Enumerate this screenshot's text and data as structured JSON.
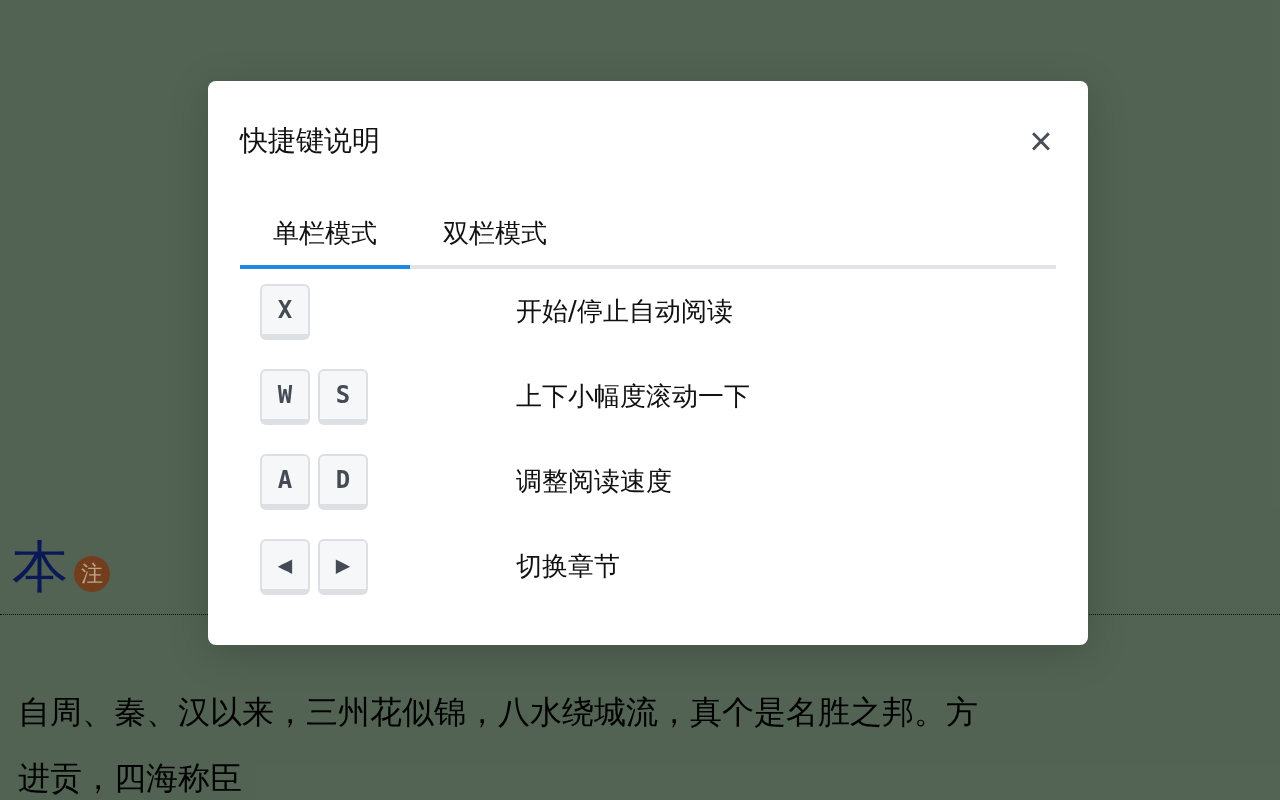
{
  "page": {
    "heading": "本",
    "note_badge": "注",
    "paragraphs": [
      "自周、秦、汉以来，三州花似锦，八水绕城流，真个是名胜之邦。方",
      "进贡，四海称臣"
    ]
  },
  "dialog": {
    "title": "快捷键说明",
    "close": "×",
    "tabs": [
      {
        "label": "单栏模式",
        "selected": true
      },
      {
        "label": "双栏模式",
        "selected": false
      }
    ],
    "shortcuts": [
      {
        "keys": [
          "X"
        ],
        "description": "开始/停止自动阅读"
      },
      {
        "keys": [
          "W",
          "S"
        ],
        "description": "上下小幅度滚动一下"
      },
      {
        "keys": [
          "A",
          "D"
        ],
        "description": "调整阅读速度"
      },
      {
        "keys": [
          "◀",
          "▶"
        ],
        "description": "切换章节"
      }
    ]
  }
}
